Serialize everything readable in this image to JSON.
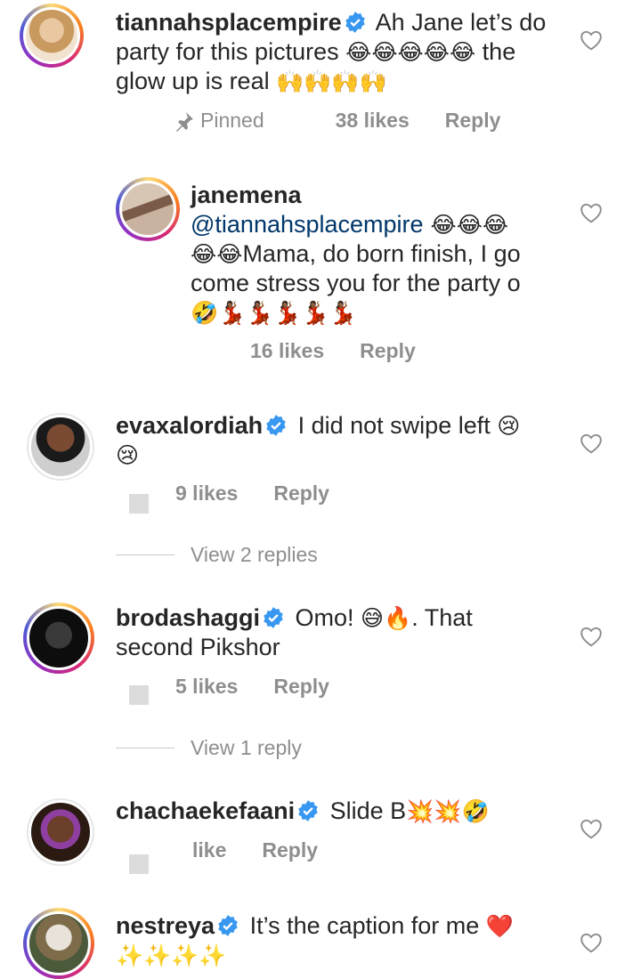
{
  "comments": [
    {
      "username": "tiannahsplacempire",
      "text_pre": "Ah Jane let’s do party for this pictures ",
      "emoji1": "😂😂😂😂😂",
      "text_mid": " the glow up is real ",
      "emoji2": "🙌🙌🙌🙌",
      "pinned": "Pinned",
      "likes": "38 likes",
      "reply": "Reply"
    },
    {
      "username": "janemena",
      "mention": "@tiannahsplacempire",
      "emoji1": " 😂😂😂",
      "emoji2": "😂😂",
      "text": "Mama, do born finish, I go come stress you for the party o",
      "emoji3": "🤣💃🏾💃🏾💃🏾💃🏾💃🏾",
      "likes": "16 likes",
      "reply": "Reply"
    },
    {
      "username": "evaxalordiah",
      "text": "I did not swipe left ",
      "emoji1": "😢",
      "emoji2": "😢",
      "likes": "9 likes",
      "reply": "Reply",
      "view_replies": "View 2 replies"
    },
    {
      "username": "brodashaggi",
      "text_pre": "Omo! ",
      "emoji1": "😅🔥",
      "text_post": ". That second Pikshor",
      "likes": "5 likes",
      "reply": "Reply",
      "view_replies": "View 1 reply"
    },
    {
      "username": "chachaekefaani",
      "text": "Slide B",
      "emoji1": "💥💥🤣",
      "likes": "like",
      "reply": "Reply"
    },
    {
      "username": "nestreya",
      "text": "It’s the caption for me ",
      "emoji1": "❤️",
      "emoji2": "✨✨✨✨"
    }
  ],
  "icons": {
    "verified": "verified-badge-icon",
    "heart": "heart-outline-icon",
    "pin": "pin-icon"
  },
  "colors": {
    "verified_blue": "#3897f0",
    "meta_gray": "#8e8e8e",
    "mention_blue": "#00376b"
  }
}
